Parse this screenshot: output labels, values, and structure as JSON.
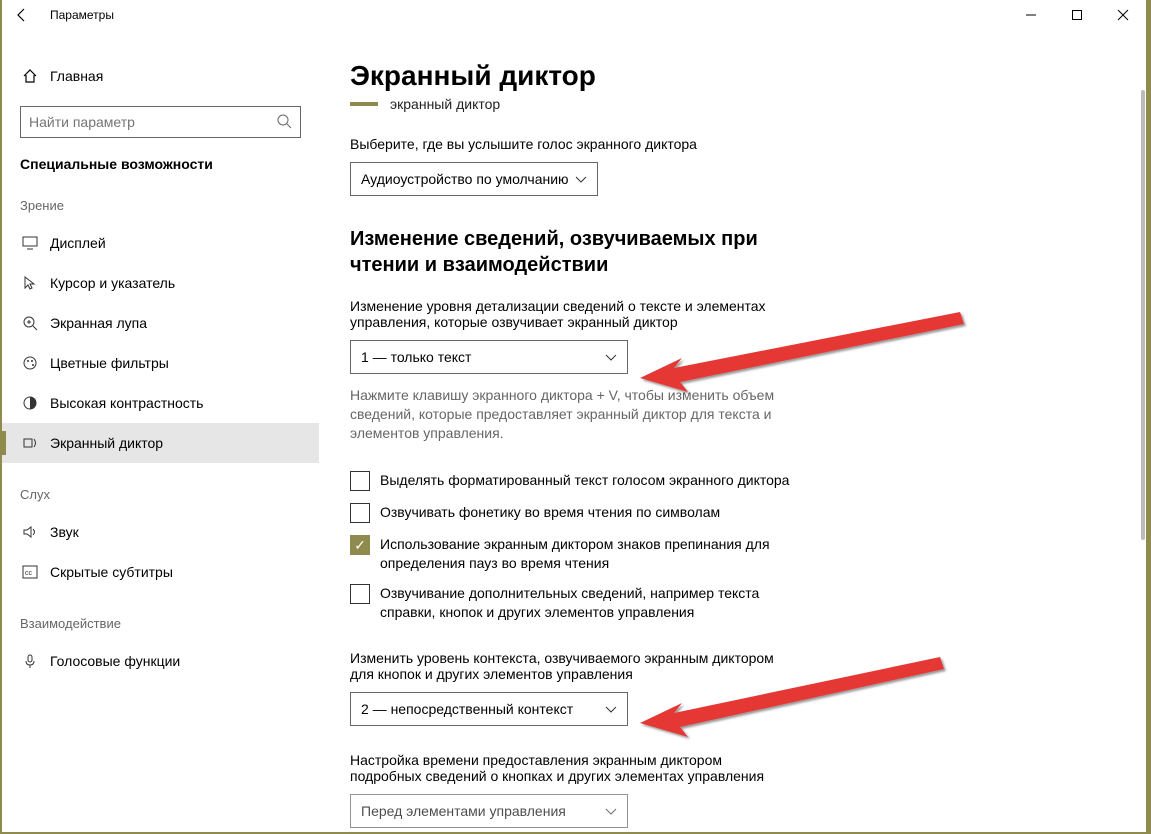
{
  "titlebar": {
    "title": "Параметры"
  },
  "sidebar": {
    "home": "Главная",
    "search_placeholder": "Найти параметр",
    "category": "Специальные возможности",
    "groups": [
      {
        "label": "Зрение",
        "items": [
          {
            "icon": "display",
            "label": "Дисплей"
          },
          {
            "icon": "cursor",
            "label": "Курсор и указатель"
          },
          {
            "icon": "magnifier",
            "label": "Экранная лупа"
          },
          {
            "icon": "filters",
            "label": "Цветные фильтры"
          },
          {
            "icon": "contrast",
            "label": "Высокая контрастность"
          },
          {
            "icon": "narrator",
            "label": "Экранный диктор",
            "selected": true
          }
        ]
      },
      {
        "label": "Слух",
        "items": [
          {
            "icon": "sound",
            "label": "Звук"
          },
          {
            "icon": "cc",
            "label": "Скрытые субтитры"
          }
        ]
      },
      {
        "label": "Взаимодействие",
        "items": [
          {
            "icon": "voice",
            "label": "Голосовые функции"
          }
        ]
      }
    ]
  },
  "main": {
    "title": "Экранный диктор",
    "trailing": "экранный диктор",
    "audio_label": "Выберите, где вы услышите голос экранного диктора",
    "audio_value": "Аудиоустройство по умолчанию",
    "section2_title": "Изменение сведений, озвучиваемых при чтении и взаимодействии",
    "detail_label": "Изменение уровня детализации сведений о тексте и элементах управления, которые озвучивает экранный диктор",
    "detail_value": "1 — только текст",
    "detail_hint": "Нажмите клавишу экранного диктора + V, чтобы изменить объем сведений, которые предоставляет экранный диктор для текста и элементов управления.",
    "cb1": "Выделять форматированный текст голосом экранного диктора",
    "cb2": "Озвучивать фонетику во время чтения по символам",
    "cb3": "Использование экранным диктором знаков препинания для определения пауз во время чтения",
    "cb4": "Озвучивание дополнительных сведений, например текста справки, кнопок и других элементов управления",
    "context_label": "Изменить уровень контекста, озвучиваемого экранным диктором для кнопок и других элементов управления",
    "context_value": "2 — непосредственный контекст",
    "timing_label": "Настройка времени предоставления экранным диктором подробных сведений о кнопках и других элементах управления",
    "timing_value": "Перед элементами управления"
  }
}
